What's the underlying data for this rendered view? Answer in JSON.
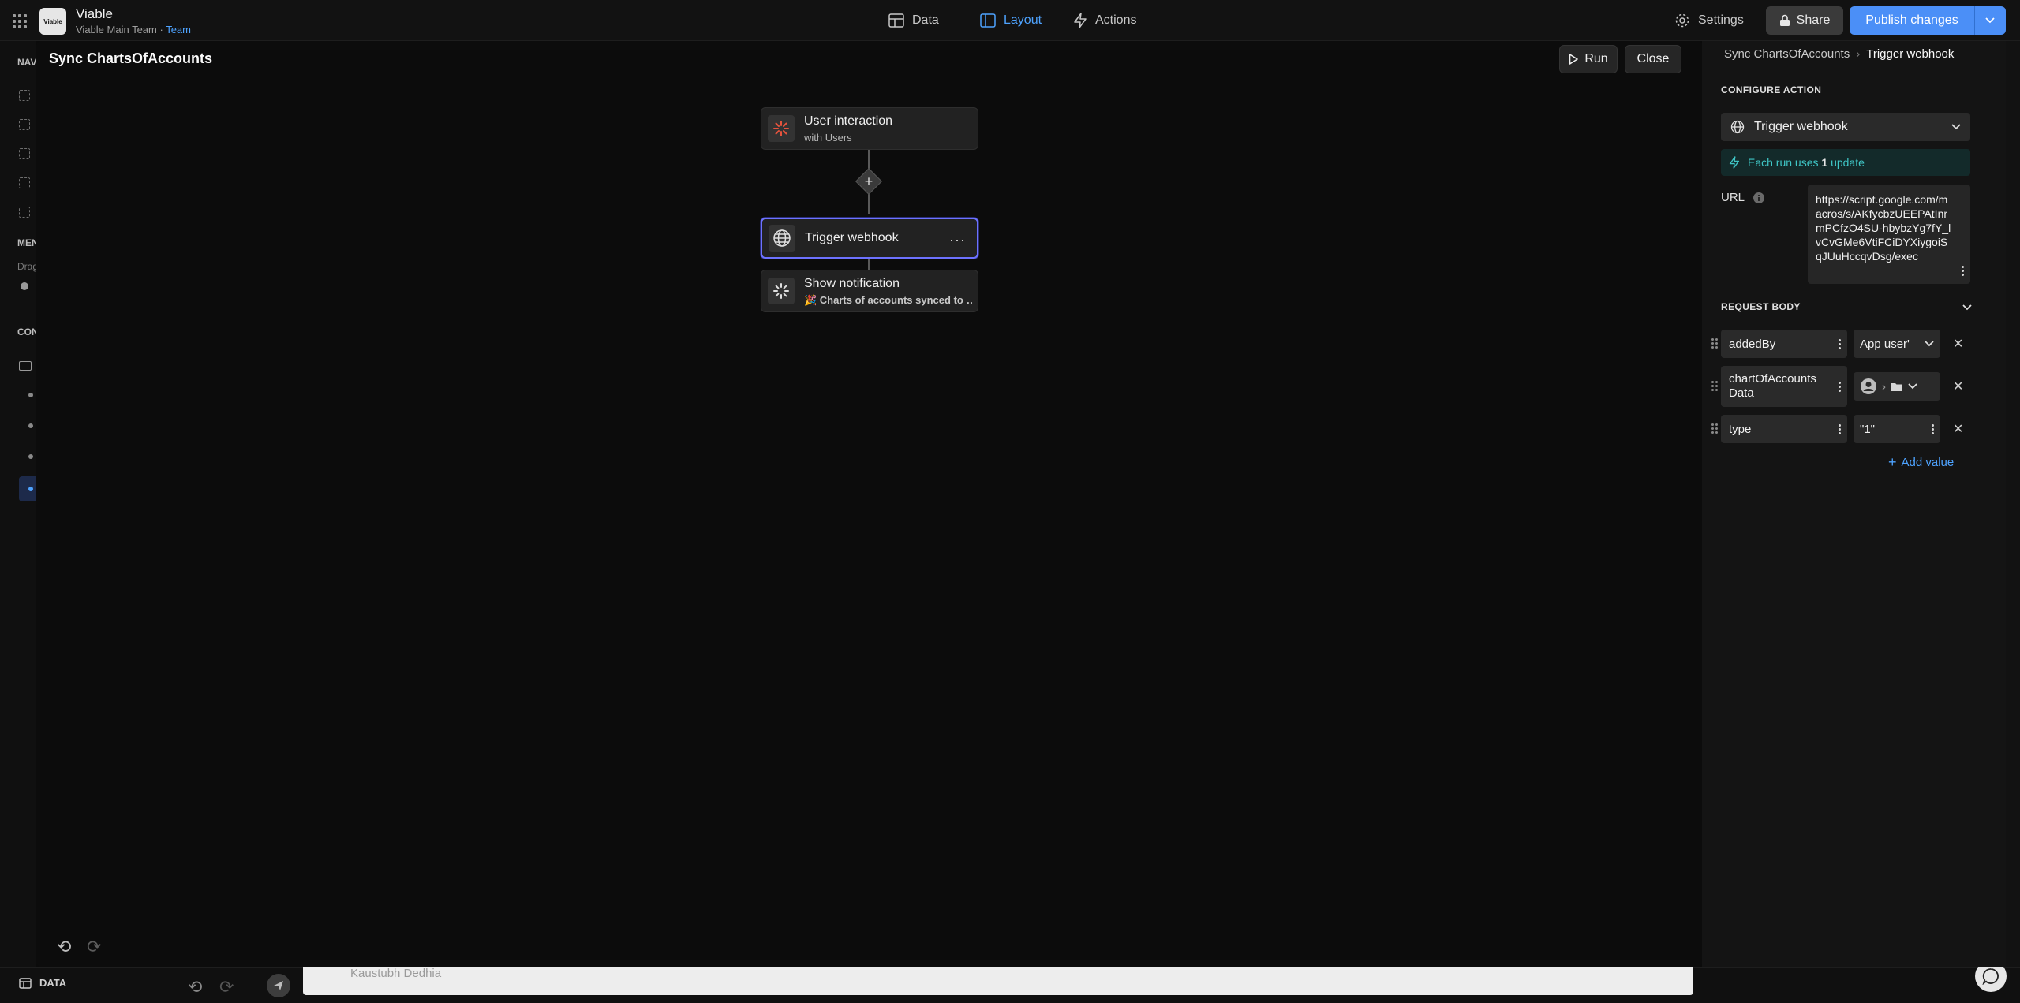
{
  "app": {
    "logo_text": "Viable",
    "title": "Viable",
    "team_name": "Viable Main Team",
    "team_separator": " · ",
    "team_tag": "Team"
  },
  "nav": {
    "tabs": [
      {
        "label": "Data",
        "active": false
      },
      {
        "label": "Layout",
        "active": true
      },
      {
        "label": "Actions",
        "active": false
      }
    ]
  },
  "toolbar": {
    "settings_label": "Settings",
    "share_label": "Share",
    "publish_label": "Publish changes"
  },
  "left_rail": {
    "labels": [
      "NAV",
      "MEN",
      "Drag",
      "CON"
    ]
  },
  "bottom": {
    "data_label": "DATA",
    "ghost_user": "Kaustubh Dedhia"
  },
  "modal": {
    "title": "Sync ChartsOfAccounts",
    "run_label": "Run",
    "close_label": "Close"
  },
  "flow": {
    "nodes": [
      {
        "title": "User interaction",
        "subtitle": "with Users",
        "icon": "spark-icon",
        "selected": false
      },
      {
        "title": "Trigger webhook",
        "subtitle": "",
        "icon": "globe-icon",
        "selected": true
      },
      {
        "title": "Show notification",
        "subtitle": "🎉 Charts of accounts synced to …",
        "icon": "spinner-icon",
        "selected": false
      }
    ],
    "add_step_symbol": "+"
  },
  "panel": {
    "breadcrumb": {
      "parent": "Sync ChartsOfAccounts",
      "current": "Trigger webhook"
    },
    "configure_label": "CONFIGURE ACTION",
    "action_value": "Trigger webhook",
    "info_prefix": "Each run uses ",
    "info_count": "1",
    "info_suffix": " update",
    "url_label": "URL",
    "url_value": "https://script.google.com/macros/s/AKfycbzUEEPAtInrmPCfzO4SU-hbybzYg7fY_lvCvGMe6VtiFCiDYXiygoiSqJUuHccqvDsg/exec",
    "request_body_label": "REQUEST BODY",
    "rows": [
      {
        "key": "addedBy",
        "value": "App user'",
        "value_type": "text"
      },
      {
        "key": "chartOfAccounts Data",
        "value": "",
        "value_type": "path"
      },
      {
        "key": "type",
        "value": "\"1\"",
        "value_type": "text"
      }
    ],
    "add_value_label": "Add value"
  },
  "colors": {
    "accent": "#4b8ff7",
    "link": "#4ea3ff",
    "selected_node": "#6d72ff",
    "info_text": "#3fc6c6"
  }
}
